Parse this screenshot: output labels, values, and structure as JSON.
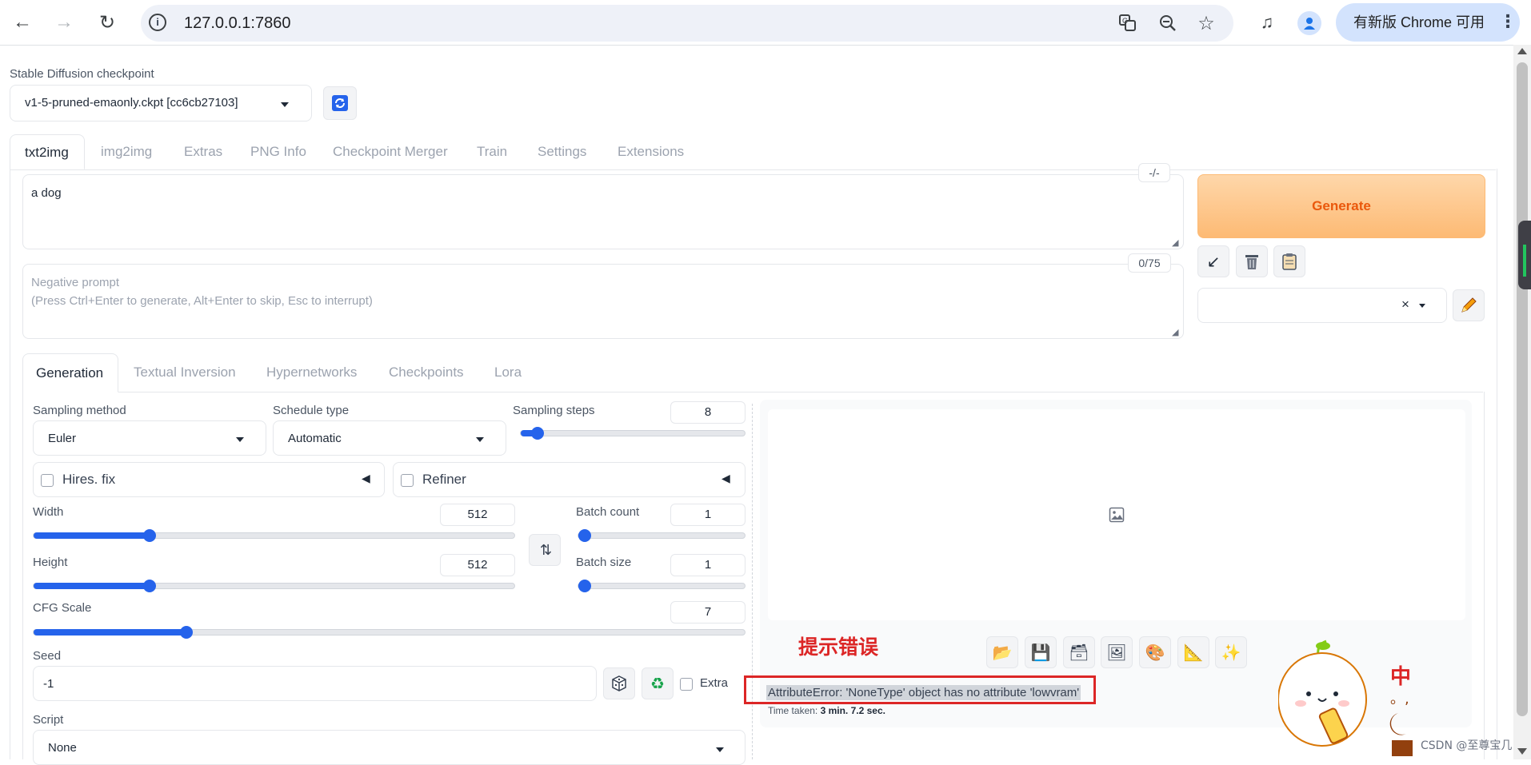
{
  "browser": {
    "url": "127.0.0.1:7860",
    "update_label": "有新版 Chrome 可用"
  },
  "checkpoint": {
    "label": "Stable Diffusion checkpoint",
    "value": "v1-5-pruned-emaonly.ckpt [cc6cb27103]"
  },
  "main_tabs": [
    "txt2img",
    "img2img",
    "Extras",
    "PNG Info",
    "Checkpoint Merger",
    "Train",
    "Settings",
    "Extensions"
  ],
  "prompt": {
    "value": "a dog",
    "counter": "-/-"
  },
  "negative_prompt": {
    "placeholder_line1": "Negative prompt",
    "placeholder_line2": "(Press Ctrl+Enter to generate, Alt+Enter to skip, Esc to interrupt)",
    "counter": "0/75"
  },
  "generate_label": "Generate",
  "sub_tabs": [
    "Generation",
    "Textual Inversion",
    "Hypernetworks",
    "Checkpoints",
    "Lora"
  ],
  "sampling": {
    "method_label": "Sampling method",
    "method_value": "Euler",
    "schedule_label": "Schedule type",
    "schedule_value": "Automatic",
    "steps_label": "Sampling steps",
    "steps_value": "8",
    "steps_level": 0.05
  },
  "hires_label": "Hires. fix",
  "refiner_label": "Refiner",
  "width": {
    "label": "Width",
    "value": "512",
    "level": 0.235
  },
  "height": {
    "label": "Height",
    "value": "512",
    "level": 0.235
  },
  "batch_count": {
    "label": "Batch count",
    "value": "1",
    "level": 0.0
  },
  "batch_size": {
    "label": "Batch size",
    "value": "1",
    "level": 0.0
  },
  "cfg": {
    "label": "CFG Scale",
    "value": "7",
    "level": 0.21
  },
  "seed": {
    "label": "Seed",
    "value": "-1",
    "extra_label": "Extra"
  },
  "script": {
    "label": "Script",
    "value": "None"
  },
  "annotation_label": "提示错误",
  "error_text": "AttributeError: 'NoneType' object has no attribute 'lowvram'",
  "time_taken_label": "Time taken:",
  "time_taken_value": "3 min. 7.2 sec.",
  "watermark": "CSDN @至尊宝几",
  "colors": {
    "accent": "#2563eb",
    "generate_text": "#ea580c",
    "error_border": "#dc2626"
  }
}
